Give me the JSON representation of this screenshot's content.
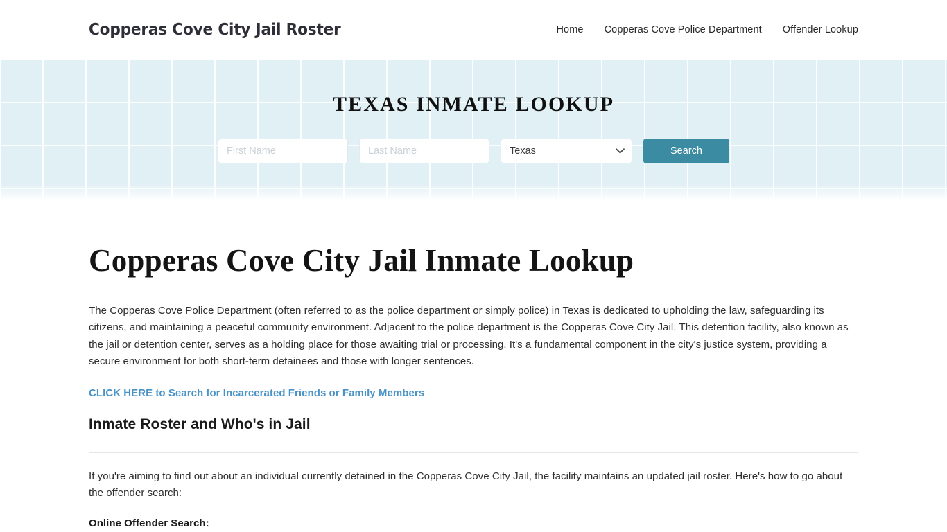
{
  "header": {
    "site_title": "Copperas Cove City Jail Roster",
    "nav": [
      {
        "label": "Home"
      },
      {
        "label": "Copperas Cove Police Department"
      },
      {
        "label": "Offender Lookup"
      }
    ]
  },
  "hero": {
    "title": "TEXAS INMATE LOOKUP",
    "first_name_placeholder": "First Name",
    "first_name_value": "",
    "last_name_placeholder": "Last Name",
    "last_name_value": "",
    "state_selected": "Texas",
    "state_options": [
      "Texas"
    ],
    "search_button_label": "Search",
    "background_color": "#e1f0f5",
    "button_color": "#3b8ba3"
  },
  "main": {
    "page_title": "Copperas Cove City Jail Inmate Lookup",
    "intro_paragraph": "The Copperas Cove Police Department (often referred to as the police department or simply police) in Texas is dedicated to upholding the law, safeguarding its citizens, and maintaining a peaceful community environment. Adjacent to the police department is the Copperas Cove City Jail. This detention facility, also known as the jail or detention center, serves as a holding place for those awaiting trial or processing. It's a fundamental component in the city's justice system, providing a secure environment for both short-term detainees and those with longer sentences.",
    "cta_link_text": "CLICK HERE to Search for Incarcerated Friends or Family Members",
    "cta_link_color": "#4a93c7",
    "section_heading": "Inmate Roster and Who's in Jail",
    "roster_paragraph": "If you're aiming to find out about an individual currently detained in the Copperas Cove City Jail, the facility maintains an updated jail roster. Here's how to go about the offender search:",
    "online_search_label": "Online Offender Search:"
  }
}
